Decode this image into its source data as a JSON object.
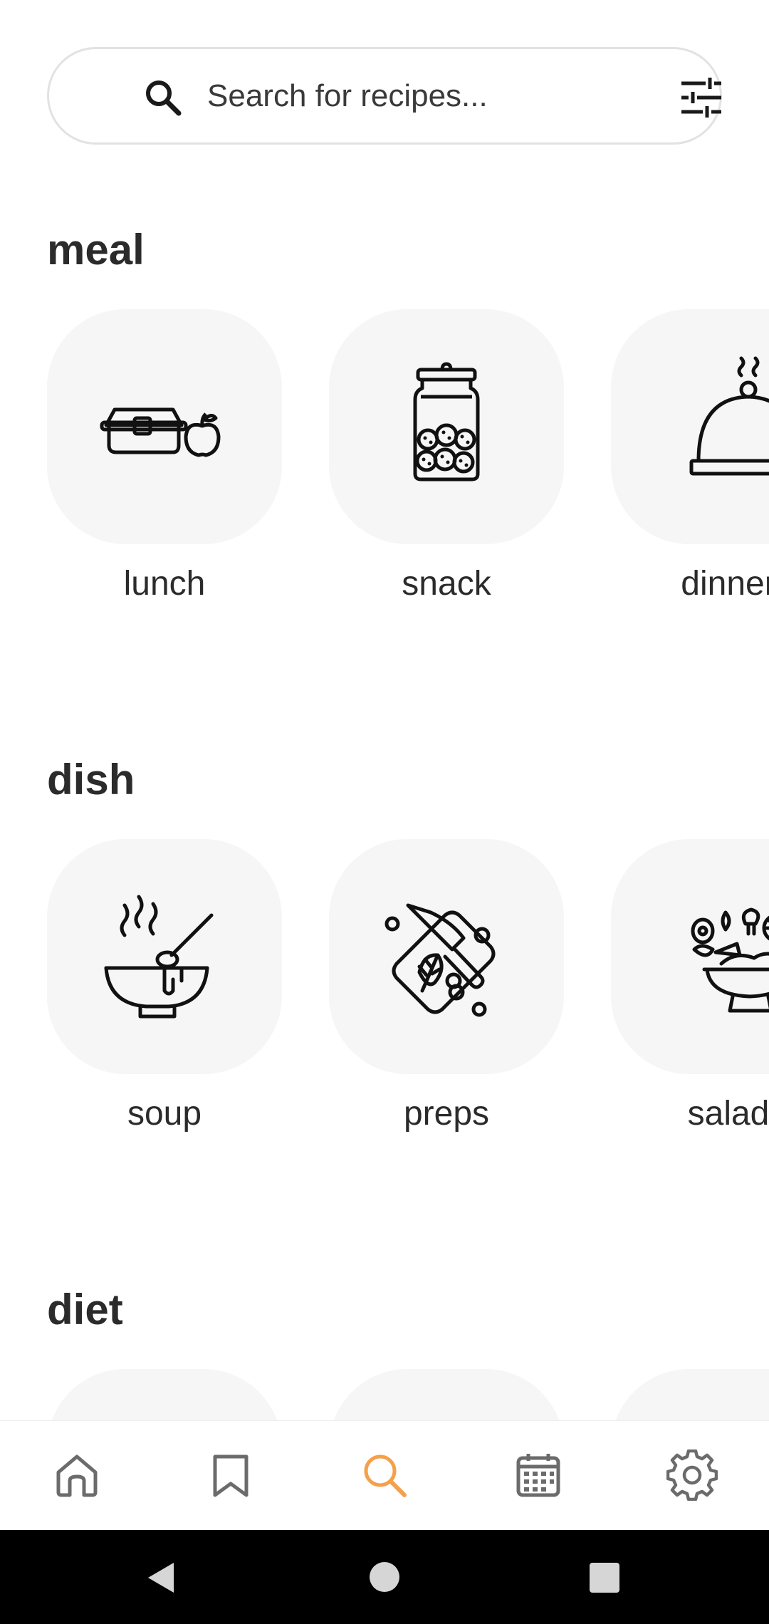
{
  "search": {
    "placeholder": "Search for recipes...",
    "icon": "search-icon",
    "filter_icon": "filter-sliders-icon"
  },
  "sections": [
    {
      "title": "meal",
      "items": [
        {
          "label": "lunch",
          "icon": "lunchbox-apple-icon"
        },
        {
          "label": "snack",
          "icon": "cookie-jar-icon"
        },
        {
          "label": "dinner",
          "icon": "cloche-icon"
        }
      ]
    },
    {
      "title": "dish",
      "items": [
        {
          "label": "soup",
          "icon": "soup-bowl-icon"
        },
        {
          "label": "preps",
          "icon": "cutting-board-knife-icon"
        },
        {
          "label": "salad",
          "icon": "salad-bowl-icon"
        }
      ]
    },
    {
      "title": "diet",
      "items": []
    }
  ],
  "bottom_nav": [
    {
      "name": "home",
      "icon": "home-icon",
      "active": false
    },
    {
      "name": "saved",
      "icon": "bookmark-icon",
      "active": false
    },
    {
      "name": "search",
      "icon": "search-icon",
      "active": true
    },
    {
      "name": "planner",
      "icon": "calendar-icon",
      "active": false
    },
    {
      "name": "settings",
      "icon": "gear-icon",
      "active": false
    }
  ],
  "colors": {
    "accent": "#F5A04A",
    "icon_inactive": "#6b6b6b",
    "card_bg": "#F6F6F6",
    "text": "#2B2B2B"
  }
}
